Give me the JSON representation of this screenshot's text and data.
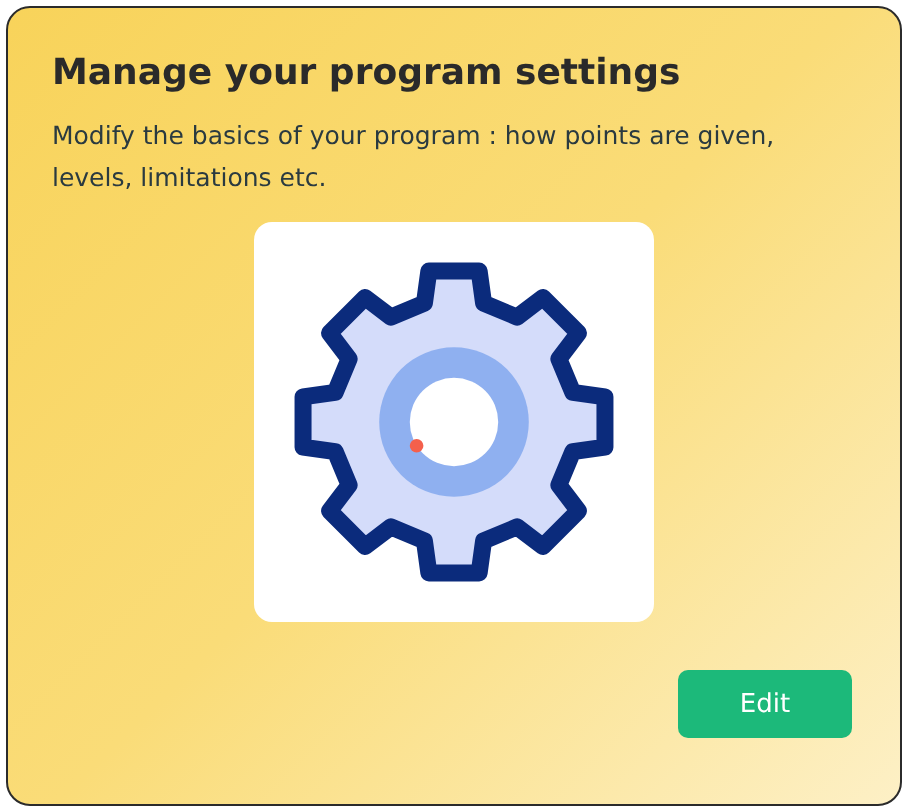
{
  "card": {
    "title": "Manage your program settings",
    "description": "Modify the basics of your program : how points are given, levels, limitations etc.",
    "button": "Edit"
  }
}
